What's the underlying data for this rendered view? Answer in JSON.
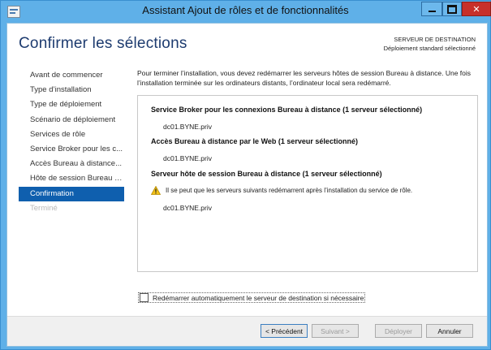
{
  "window": {
    "title": "Assistant Ajout de rôles et de fonctionnalités"
  },
  "header": {
    "page_title": "Confirmer les sélections",
    "destination_label": "SERVEUR DE DESTINATION",
    "destination_value": "Déploiement standard sélectionné"
  },
  "nav": {
    "items": [
      {
        "label": "Avant de commencer",
        "state": "normal"
      },
      {
        "label": "Type d’installation",
        "state": "normal"
      },
      {
        "label": "Type de déploiement",
        "state": "normal"
      },
      {
        "label": "Scénario de déploiement",
        "state": "normal"
      },
      {
        "label": "Services de rôle",
        "state": "normal"
      },
      {
        "label": "Service Broker pour les c...",
        "state": "normal"
      },
      {
        "label": "Accès Bureau à distance...",
        "state": "normal"
      },
      {
        "label": "Hôte de session Bureau à...",
        "state": "normal"
      },
      {
        "label": "Confirmation",
        "state": "active"
      },
      {
        "label": "Terminé",
        "state": "disabled"
      }
    ]
  },
  "main": {
    "intro": "Pour terminer l’installation, vous devez redémarrer les serveurs hôtes de session Bureau à distance. Une fois l’installation terminée sur les ordinateurs distants, l’ordinateur local sera redémarré.",
    "sections": [
      {
        "title": "Service Broker pour les connexions Bureau à distance  (1 serveur sélectionné)",
        "server": "dc01.BYNE.priv"
      },
      {
        "title": "Accès Bureau à distance par le Web  (1 serveur sélectionné)",
        "server": "dc01.BYNE.priv"
      },
      {
        "title": "Serveur hôte de session Bureau à distance  (1 serveur sélectionné)",
        "server": "dc01.BYNE.priv"
      }
    ],
    "warning": "Il se peut que les serveurs suivants redémarrent après l’installation du service de rôle.",
    "restart_checkbox_label": "Redémarrer automatiquement le serveur de destination si nécessaire",
    "restart_checked": false
  },
  "footer": {
    "prev": "< Précédent",
    "next": "Suivant >",
    "deploy": "Déployer",
    "cancel": "Annuler"
  },
  "colors": {
    "title_bar": "#5fb0e8",
    "nav_active": "#0f5fae",
    "page_title": "#1d3b6f",
    "close_button": "#c7302a"
  }
}
